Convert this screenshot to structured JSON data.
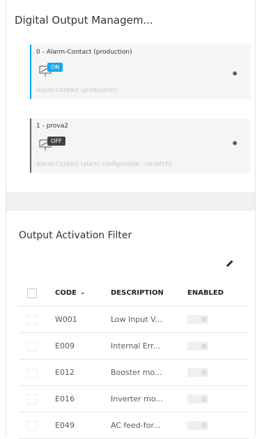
{
  "digital_output": {
    "title": "Digital Output Managem...",
    "cards": [
      {
        "title": "0 - Alarm-Contact (production)",
        "state": "ON",
        "subtitle": "Alarm-Contact (production)"
      },
      {
        "title": "1 - prova2",
        "state": "OFF",
        "subtitle": "Alarm-Contact (alarm configurable - no-latch)"
      }
    ]
  },
  "filter": {
    "title": "Output Activation Filter",
    "headers": {
      "code": "CODE",
      "description": "DESCRIPTION",
      "enabled": "ENABLED"
    },
    "rows": [
      {
        "code": "W001",
        "description": "Low Input V..."
      },
      {
        "code": "E009",
        "description": "Internal Err..."
      },
      {
        "code": "E012",
        "description": "Booster mo..."
      },
      {
        "code": "E016",
        "description": "Inverter mo..."
      },
      {
        "code": "E049",
        "description": "AC feed-for..."
      }
    ]
  },
  "colors": {
    "accent": "#18a8ec",
    "off": "#444444"
  },
  "icons": {
    "card_icon": "switch-output-icon",
    "settings": "gear-icon",
    "edit": "pencil-icon",
    "sort": "chevron-down-icon"
  }
}
